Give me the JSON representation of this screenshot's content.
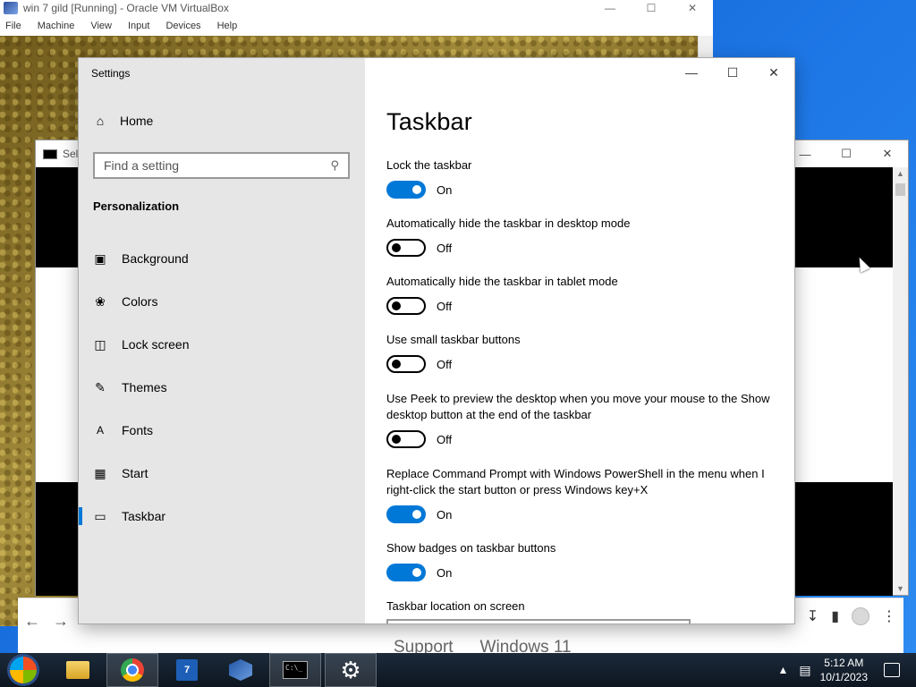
{
  "vbox": {
    "title": "win 7 gild [Running] - Oracle VM VirtualBox",
    "menu": [
      "File",
      "Machine",
      "View",
      "Input",
      "Devices",
      "Help"
    ]
  },
  "console": {
    "title": "Sele"
  },
  "browser": {
    "tabs": [
      "Support",
      "Windows 11"
    ]
  },
  "settings": {
    "app_title": "Settings",
    "home_label": "Home",
    "search_placeholder": "Find a setting",
    "section": "Personalization",
    "nav": [
      {
        "label": "Background",
        "icon": "image-icon"
      },
      {
        "label": "Colors",
        "icon": "palette-icon"
      },
      {
        "label": "Lock screen",
        "icon": "lock-screen-icon"
      },
      {
        "label": "Themes",
        "icon": "themes-icon"
      },
      {
        "label": "Fonts",
        "icon": "fonts-icon"
      },
      {
        "label": "Start",
        "icon": "start-icon"
      },
      {
        "label": "Taskbar",
        "icon": "taskbar-icon",
        "selected": true
      }
    ],
    "page_title": "Taskbar",
    "options": [
      {
        "label": "Lock the taskbar",
        "state": "On"
      },
      {
        "label": "Automatically hide the taskbar in desktop mode",
        "state": "Off"
      },
      {
        "label": "Automatically hide the taskbar in tablet mode",
        "state": "Off"
      },
      {
        "label": "Use small taskbar buttons",
        "state": "Off"
      },
      {
        "label": "Use Peek to preview the desktop when you move your mouse to the Show desktop button at the end of the taskbar",
        "state": "Off"
      },
      {
        "label": "Replace Command Prompt with Windows PowerShell in the menu when I right-click the start button or press Windows key+X",
        "state": "On"
      },
      {
        "label": "Show badges on taskbar buttons",
        "state": "On"
      }
    ],
    "location_label": "Taskbar location on screen"
  },
  "taskbar": {
    "time": "5:12 AM",
    "date": "10/1/2023"
  },
  "colors": {
    "accent": "#0078d7"
  }
}
